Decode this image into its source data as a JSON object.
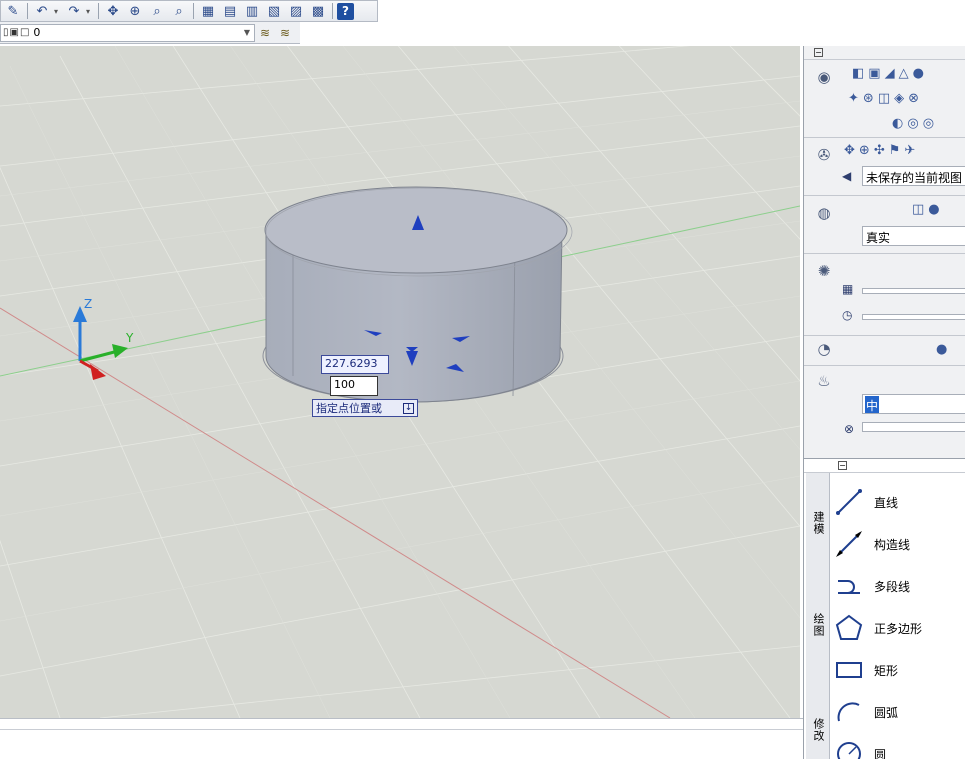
{
  "toolbar": {
    "buttons": [
      {
        "name": "match-properties-icon",
        "glyph": "✎"
      },
      {
        "name": "undo-icon",
        "glyph": "↶"
      },
      {
        "name": "redo-icon",
        "glyph": "↷"
      },
      {
        "name": "pan-icon",
        "glyph": "✥"
      },
      {
        "name": "zoom-realtime-icon",
        "glyph": "⊕"
      },
      {
        "name": "zoom-window-icon",
        "glyph": "⌕"
      },
      {
        "name": "zoom-previous-icon",
        "glyph": "⌕"
      },
      {
        "name": "properties-icon",
        "glyph": "▦"
      },
      {
        "name": "design-center-icon",
        "glyph": "▤"
      },
      {
        "name": "tool-palettes-icon",
        "glyph": "▥"
      },
      {
        "name": "sheet-set-icon",
        "glyph": "▧"
      },
      {
        "name": "markup-icon",
        "glyph": "▨"
      },
      {
        "name": "calculator-icon",
        "glyph": "▩"
      },
      {
        "name": "help-icon",
        "glyph": "?"
      }
    ]
  },
  "layer": {
    "current": "0"
  },
  "viewport": {
    "ucs": {
      "z": "Z",
      "y": "Y"
    },
    "dynamic_input": {
      "value": "227.6293",
      "length": "100",
      "prompt": "指定点位置或"
    }
  },
  "dashboard": {
    "view_field": "未保存的当前视图",
    "visual_style_field": "真实",
    "material_field": "中"
  },
  "draw_palette": {
    "tabs": [
      "建模",
      "绘图",
      "修改"
    ],
    "items": [
      {
        "label": "直线",
        "icon": "line-icon"
      },
      {
        "label": "构造线",
        "icon": "construction-line-icon"
      },
      {
        "label": "多段线",
        "icon": "polyline-icon"
      },
      {
        "label": "正多边形",
        "icon": "polygon-icon"
      },
      {
        "label": "矩形",
        "icon": "rectangle-icon"
      },
      {
        "label": "圆弧",
        "icon": "arc-icon"
      },
      {
        "label": "圆",
        "icon": "circle-icon"
      }
    ]
  }
}
